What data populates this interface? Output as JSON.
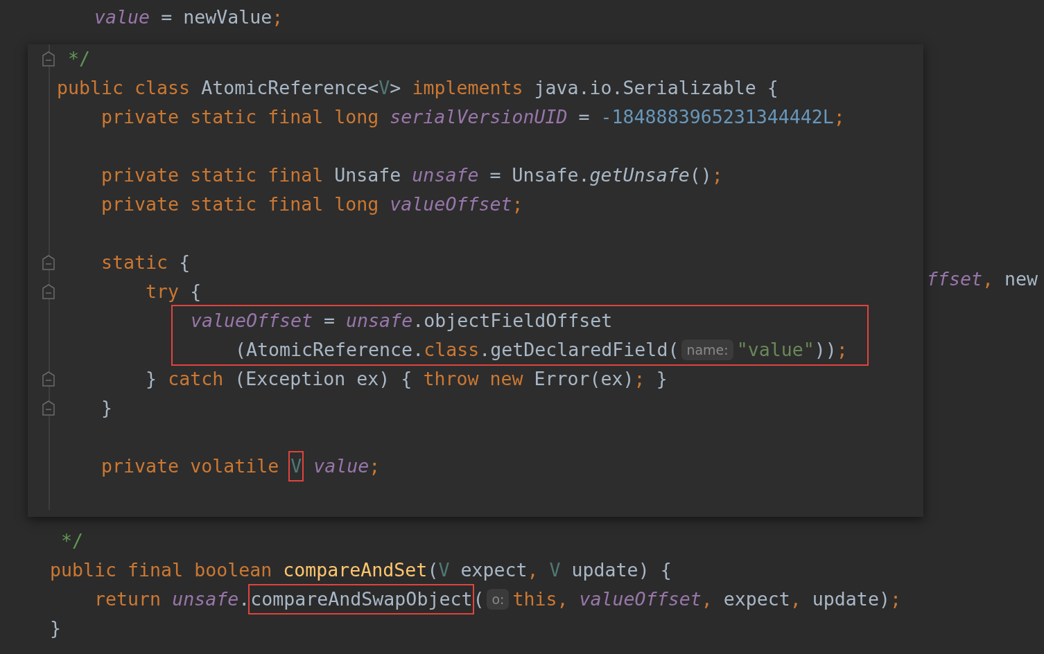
{
  "editor": {
    "lines": [
      {
        "kind": "code",
        "tokens": [
          {
            "kind": "field",
            "text": "    value"
          },
          {
            "kind": "plain",
            "text": " = newValue"
          },
          {
            "kind": "keyword",
            "text": ";"
          }
        ]
      },
      {
        "kind": "blank"
      },
      {
        "kind": "blank"
      },
      {
        "kind": "blank"
      },
      {
        "kind": "blank"
      },
      {
        "kind": "blank"
      },
      {
        "kind": "blank"
      },
      {
        "kind": "blank"
      },
      {
        "kind": "blank"
      },
      {
        "kind": "code",
        "tokens": [
          {
            "kind": "field",
            "text": "                                                                               ffset"
          },
          {
            "kind": "keyword",
            "text": ", "
          },
          {
            "kind": "plain",
            "text": "new"
          }
        ]
      },
      {
        "kind": "blank"
      },
      {
        "kind": "blank"
      },
      {
        "kind": "blank"
      },
      {
        "kind": "blank"
      },
      {
        "kind": "blank"
      },
      {
        "kind": "blank"
      },
      {
        "kind": "blank"
      },
      {
        "kind": "blank"
      },
      {
        "kind": "code",
        "tokens": [
          {
            "kind": "comment",
            "text": " */"
          }
        ]
      },
      {
        "kind": "code",
        "tokens": [
          {
            "kind": "keyword",
            "text": "public final boolean "
          },
          {
            "kind": "method",
            "text": "compareAndSet"
          },
          {
            "kind": "plain",
            "text": "("
          },
          {
            "kind": "type",
            "text": "V"
          },
          {
            "kind": "plain",
            "text": " expect"
          },
          {
            "kind": "keyword",
            "text": ", "
          },
          {
            "kind": "type",
            "text": "V"
          },
          {
            "kind": "plain",
            "text": " update) {"
          }
        ]
      },
      {
        "kind": "code",
        "tokens": [
          {
            "kind": "keyword",
            "text": "    return "
          },
          {
            "kind": "field",
            "text": "unsafe"
          },
          {
            "kind": "plain",
            "text": "."
          },
          {
            "kind": "plain",
            "text": "compareAndSwapObject",
            "boxed": true
          },
          {
            "kind": "plain",
            "text": "("
          },
          {
            "kind": "hint",
            "text": "o:"
          },
          {
            "kind": "keyword",
            "text": "this, "
          },
          {
            "kind": "field",
            "text": "valueOffset"
          },
          {
            "kind": "keyword",
            "text": ","
          },
          {
            "kind": "plain",
            "text": " expect"
          },
          {
            "kind": "keyword",
            "text": ","
          },
          {
            "kind": "plain",
            "text": " update)"
          },
          {
            "kind": "keyword",
            "text": ";"
          }
        ]
      },
      {
        "kind": "code",
        "tokens": [
          {
            "kind": "plain",
            "text": "}"
          }
        ]
      }
    ]
  },
  "popup": {
    "lines": [
      {
        "kind": "code",
        "fold": true,
        "tokens": [
          {
            "kind": "comment",
            "text": " */"
          }
        ]
      },
      {
        "kind": "code",
        "fold": false,
        "tokens": [
          {
            "kind": "keyword",
            "text": "public class "
          },
          {
            "kind": "plain",
            "text": "AtomicReference<"
          },
          {
            "kind": "type",
            "text": "V"
          },
          {
            "kind": "plain",
            "text": "> "
          },
          {
            "kind": "keyword",
            "text": "implements "
          },
          {
            "kind": "plain",
            "text": "java.io.Serializable {"
          }
        ]
      },
      {
        "kind": "code",
        "fold": false,
        "tokens": [
          {
            "kind": "keyword",
            "text": "    private static final long "
          },
          {
            "kind": "field",
            "text": "serialVersionUID"
          },
          {
            "kind": "plain",
            "text": " = "
          },
          {
            "kind": "number",
            "text": "-1848883965231344442L"
          },
          {
            "kind": "keyword",
            "text": ";"
          }
        ]
      },
      {
        "kind": "blank",
        "fold": false
      },
      {
        "kind": "code",
        "fold": false,
        "tokens": [
          {
            "kind": "keyword",
            "text": "    private static final "
          },
          {
            "kind": "plain",
            "text": "Unsafe "
          },
          {
            "kind": "field",
            "text": "unsafe"
          },
          {
            "kind": "plain",
            "text": " = Unsafe."
          },
          {
            "kind": "static_call",
            "text": "getUnsafe"
          },
          {
            "kind": "plain",
            "text": "()"
          },
          {
            "kind": "keyword",
            "text": ";"
          }
        ]
      },
      {
        "kind": "code",
        "fold": false,
        "tokens": [
          {
            "kind": "keyword",
            "text": "    private static final long "
          },
          {
            "kind": "field",
            "text": "valueOffset"
          },
          {
            "kind": "keyword",
            "text": ";"
          }
        ]
      },
      {
        "kind": "blank",
        "fold": false
      },
      {
        "kind": "code",
        "fold": true,
        "tokens": [
          {
            "kind": "keyword",
            "text": "    static "
          },
          {
            "kind": "plain",
            "text": "{"
          }
        ]
      },
      {
        "kind": "code",
        "fold": true,
        "tokens": [
          {
            "kind": "keyword",
            "text": "        try "
          },
          {
            "kind": "plain",
            "text": "{"
          }
        ]
      },
      {
        "kind": "code",
        "fold": false,
        "boxed": true,
        "tokens": [
          {
            "kind": "field",
            "text": "            valueOffset"
          },
          {
            "kind": "plain",
            "text": " = "
          },
          {
            "kind": "field",
            "text": "unsafe"
          },
          {
            "kind": "plain",
            "text": ".objectFieldOffset"
          }
        ]
      },
      {
        "kind": "code",
        "fold": false,
        "boxed": true,
        "tokens": [
          {
            "kind": "plain",
            "text": "                (AtomicReference."
          },
          {
            "kind": "keyword",
            "text": "class"
          },
          {
            "kind": "plain",
            "text": ".getDeclaredField("
          },
          {
            "kind": "hint",
            "text": "name:"
          },
          {
            "kind": "string",
            "text": "\"value\""
          },
          {
            "kind": "plain",
            "text": "))"
          },
          {
            "kind": "keyword",
            "text": ";"
          }
        ]
      },
      {
        "kind": "code",
        "fold": true,
        "tokens": [
          {
            "kind": "plain",
            "text": "        } "
          },
          {
            "kind": "keyword",
            "text": "catch "
          },
          {
            "kind": "plain",
            "text": "(Exception ex) { "
          },
          {
            "kind": "keyword",
            "text": "throw new "
          },
          {
            "kind": "plain",
            "text": "Error(ex)"
          },
          {
            "kind": "keyword",
            "text": ";"
          },
          {
            "kind": "plain",
            "text": " }"
          }
        ]
      },
      {
        "kind": "code",
        "fold": true,
        "tokens": [
          {
            "kind": "plain",
            "text": "    }"
          }
        ]
      },
      {
        "kind": "blank",
        "fold": false
      },
      {
        "kind": "code",
        "fold": false,
        "tokens": [
          {
            "kind": "keyword",
            "text": "    private volatile "
          },
          {
            "kind": "type",
            "text": "V",
            "boxed": true
          },
          {
            "kind": "field",
            "text": " value"
          },
          {
            "kind": "keyword",
            "text": ";"
          }
        ]
      },
      {
        "kind": "blank",
        "fold": false
      }
    ]
  }
}
